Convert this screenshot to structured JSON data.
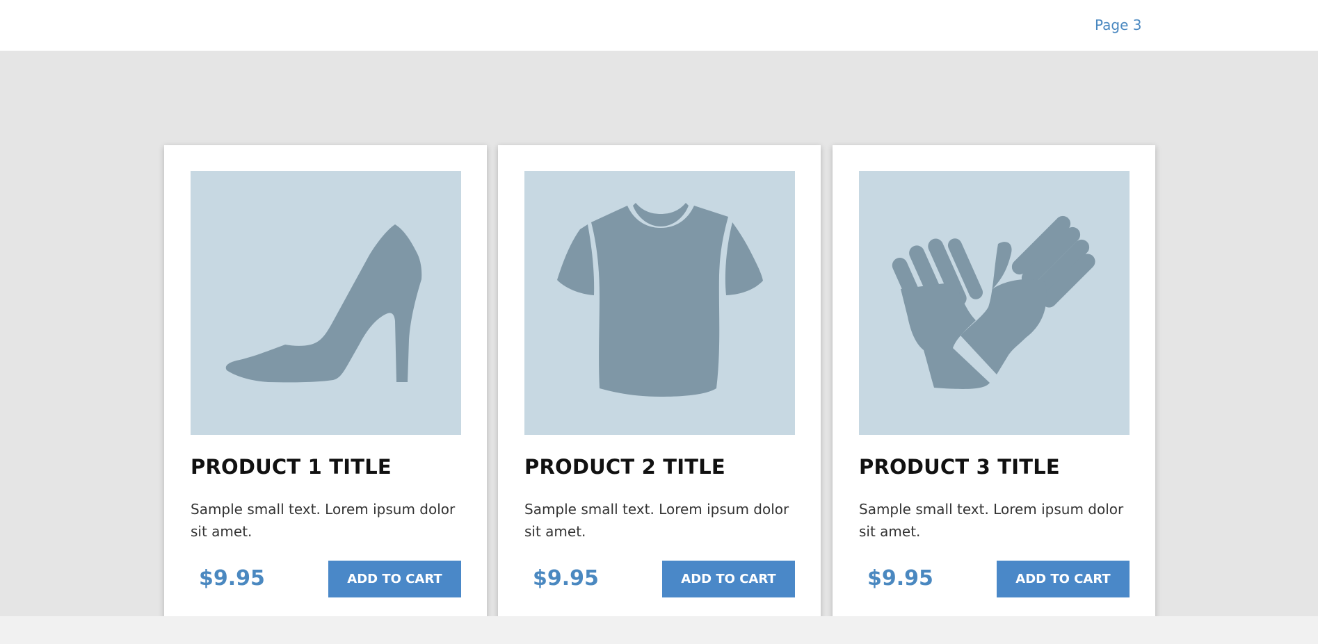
{
  "header": {
    "page_link": "Page 3"
  },
  "colors": {
    "accent": "#4a88c8",
    "image_bg": "#c7d8e2",
    "icon_fill": "#7f97a6",
    "band_bg": "#e5e5e5"
  },
  "products": [
    {
      "icon": "high-heel-shoe-icon",
      "title": "PRODUCT 1 TITLE",
      "description": "Sample small text. Lorem ipsum dolor sit amet.",
      "price": "$9.95",
      "button_label": "ADD TO CART"
    },
    {
      "icon": "t-shirt-icon",
      "title": "PRODUCT 2 TITLE",
      "description": "Sample small text. Lorem ipsum dolor sit amet.",
      "price": "$9.95",
      "button_label": "ADD TO CART"
    },
    {
      "icon": "gloves-icon",
      "title": "PRODUCT 3 TITLE",
      "description": "Sample small text. Lorem ipsum dolor sit amet.",
      "price": "$9.95",
      "button_label": "ADD TO CART"
    }
  ]
}
